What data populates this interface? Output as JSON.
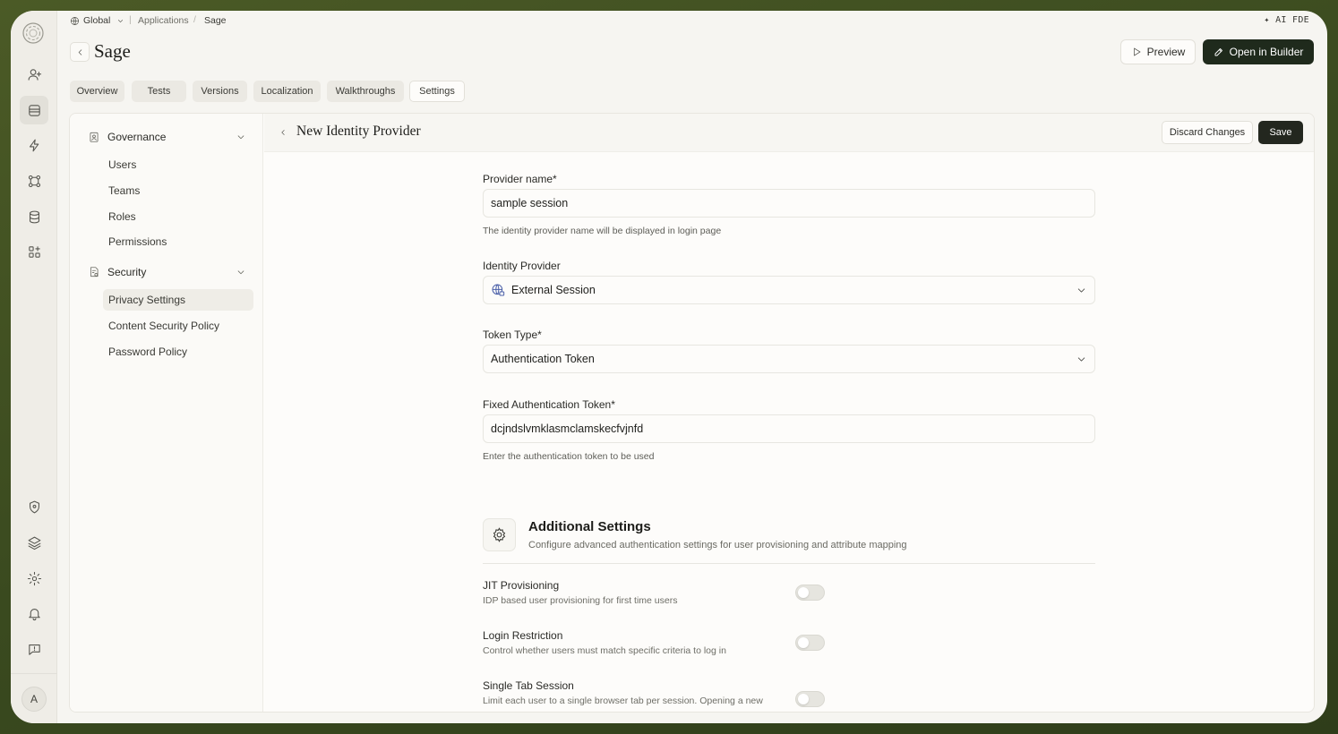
{
  "breadcrumb": {
    "scope": "Global",
    "section": "Applications",
    "current": "Sage"
  },
  "ai_label": "✦ AI FDE",
  "header": {
    "title": "Sage",
    "preview_label": "Preview",
    "builder_label": "Open in Builder"
  },
  "tabs": [
    {
      "label": "Overview"
    },
    {
      "label": "Tests"
    },
    {
      "label": "Versions"
    },
    {
      "label": "Localization"
    },
    {
      "label": "Walkthroughs"
    },
    {
      "label": "Settings",
      "active": true
    }
  ],
  "subnav": {
    "groups": [
      {
        "label": "Governance",
        "items": [
          "Users",
          "Teams",
          "Roles",
          "Permissions"
        ]
      },
      {
        "label": "Security",
        "items": [
          "Privacy Settings",
          "Content Security Policy",
          "Password Policy"
        ],
        "active_item": "Privacy Settings"
      }
    ]
  },
  "panel": {
    "title": "New Identity Provider",
    "discard_label": "Discard Changes",
    "save_label": "Save"
  },
  "form": {
    "provider_name": {
      "label": "Provider name*",
      "value": "sample session",
      "help": "The identity provider name will be displayed in login page"
    },
    "identity_provider": {
      "label": "Identity Provider",
      "value": "External Session"
    },
    "token_type": {
      "label": "Token Type*",
      "value": "Authentication Token"
    },
    "fixed_token": {
      "label": "Fixed Authentication Token*",
      "value": "dcjndslvmklasmclamskecfvjnfd",
      "help": "Enter the authentication token to be used"
    }
  },
  "additional_settings": {
    "title": "Additional Settings",
    "subtitle": "Configure advanced authentication settings for user provisioning and attribute mapping",
    "options": [
      {
        "title": "JIT Provisioning",
        "desc": "IDP based user provisioning for first time users",
        "enabled": false
      },
      {
        "title": "Login Restriction",
        "desc": "Control whether users must match specific criteria to log in",
        "enabled": false
      },
      {
        "title": "Single Tab Session",
        "desc": "Limit each user to a single browser tab per session. Opening a new",
        "enabled": false
      }
    ]
  },
  "avatar_initial": "A",
  "colors": {
    "primary_button": "#1f2a1c",
    "background": "#f6f5f1",
    "frame": "#3a4a1f"
  }
}
